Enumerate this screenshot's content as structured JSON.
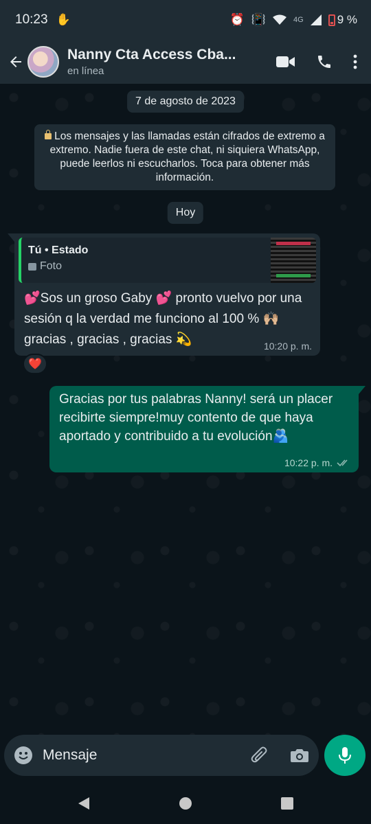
{
  "status_bar": {
    "time": "10:23",
    "network": "4G",
    "battery": "9 %"
  },
  "header": {
    "title": "Nanny Cta Access Cba...",
    "subtitle": "en línea"
  },
  "chat": {
    "date_label": "7 de agosto de 2023",
    "encryption_notice": "Los mensajes y las llamadas están cifrados de extremo a extremo. Nadie fuera de este chat, ni siquiera WhatsApp, puede leerlos ni escucharlos. Toca para obtener más información.",
    "today_label": "Hoy",
    "incoming": {
      "quote_author": "Tú • Estado",
      "quote_type": "Foto",
      "text": "💕Sos un groso Gaby 💕 pronto vuelvo por una sesión q la verdad me funciono al 100 % 🙌🏼 gracias , gracias , gracias 💫",
      "time": "10:20 p. m.",
      "reaction": "❤️"
    },
    "outgoing": {
      "text": "Gracias por tus palabras Nanny! será un placer recibirte siempre!muy contento de que haya aportado y contribuido a tu evolución🫂",
      "time": "10:22 p. m."
    }
  },
  "composer": {
    "placeholder": "Mensaje"
  },
  "colors": {
    "background": "#0b141a",
    "bar": "#1f2c34",
    "outgoing_bubble": "#005c4b",
    "accent": "#00a884"
  },
  "icons": [
    "back-arrow-icon",
    "video-call-icon",
    "phone-icon",
    "more-vert-icon",
    "emoji-icon",
    "attach-icon",
    "camera-icon",
    "mic-icon",
    "nav-back-icon",
    "nav-home-icon",
    "nav-recents-icon"
  ]
}
